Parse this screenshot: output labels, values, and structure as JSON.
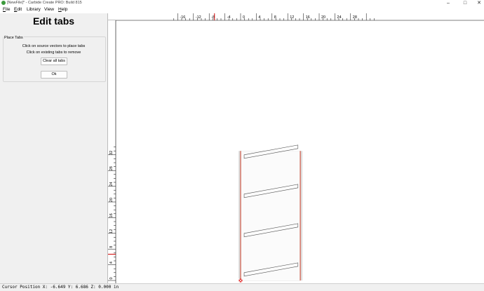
{
  "window": {
    "title": "[NewFile]* - Carbide Create PRO: Build 815",
    "minimize_glyph": "–",
    "maximize_glyph": "□",
    "close_glyph": "✕"
  },
  "menu": [
    {
      "key": "F",
      "rest": "ile"
    },
    {
      "key": "E",
      "rest": "dit"
    },
    {
      "key": "",
      "rest": "Library"
    },
    {
      "key": "",
      "rest": "View"
    },
    {
      "key": "H",
      "rest": "elp"
    }
  ],
  "panel": {
    "title": "Edit tabs",
    "group_label": "Place Tabs",
    "hint1": "Click on source vectors to place tabs",
    "hint2": "Click on existing tabs to remove",
    "clear_label": "Clear all tabs",
    "ok_label": "Ok"
  },
  "status": {
    "text": "Cursor Position X: -6.649 Y: 6.686 Z: 0.000 in"
  },
  "rulers": {
    "x_labels": [
      "-16",
      "-12",
      "-8",
      "-4",
      "0",
      "4",
      "8",
      "12",
      "16",
      "20",
      "24",
      "28"
    ],
    "x_values": [
      -16,
      -12,
      -8,
      -4,
      0,
      4,
      8,
      12,
      16,
      20,
      24,
      28
    ],
    "y_labels": [
      "32",
      "28",
      "24",
      "20",
      "16",
      "12",
      "8",
      "4",
      "0"
    ],
    "y_values": [
      32,
      28,
      24,
      20,
      16,
      12,
      8,
      4,
      0
    ],
    "cursor_x": -6.649,
    "cursor_y": 6.686
  },
  "colors": {
    "grid": "#d8d8d8",
    "grid_major": "#c8c8c8",
    "stock_edge": "#8c8c8c",
    "stock_edge_red": "#c75a4a",
    "vector": "#555555",
    "origin": "#e02020",
    "cursor_marker": "#d00000"
  }
}
